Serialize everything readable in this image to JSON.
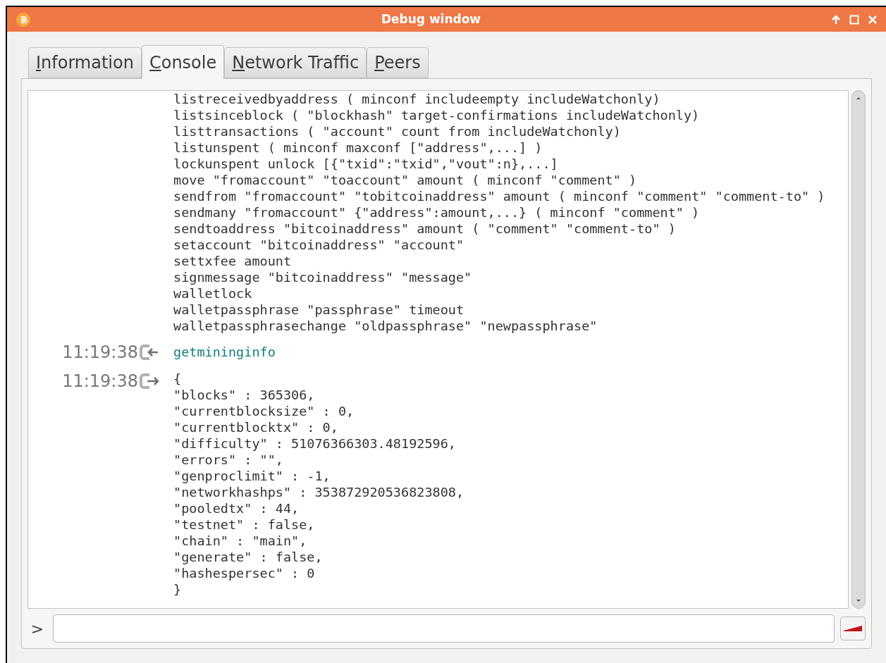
{
  "window": {
    "title": "Debug window"
  },
  "tabs": [
    {
      "label": "Information",
      "selected": false
    },
    {
      "label": "Console",
      "selected": true
    },
    {
      "label": "Network Traffic",
      "selected": false
    },
    {
      "label": "Peers",
      "selected": false
    }
  ],
  "console": {
    "entries": [
      {
        "kind": "reply",
        "lines": [
          "listreceivedbyaddress ( minconf includeempty includeWatchonly)",
          "listsinceblock ( \"blockhash\" target-confirmations includeWatchonly)",
          "listtransactions ( \"account\" count from includeWatchonly)",
          "listunspent ( minconf maxconf [\"address\",...] )",
          "lockunspent unlock [{\"txid\":\"txid\",\"vout\":n},...]",
          "move \"fromaccount\" \"toaccount\" amount ( minconf \"comment\" )",
          "sendfrom \"fromaccount\" \"tobitcoinaddress\" amount ( minconf \"comment\" \"comment-to\" )",
          "sendmany \"fromaccount\" {\"address\":amount,...} ( minconf \"comment\" )",
          "sendtoaddress \"bitcoinaddress\" amount ( \"comment\" \"comment-to\" )",
          "setaccount \"bitcoinaddress\" \"account\"",
          "settxfee amount",
          "signmessage \"bitcoinaddress\" \"message\"",
          "walletlock",
          "walletpassphrase \"passphrase\" timeout",
          "walletpassphrasechange \"oldpassphrase\" \"newpassphrase\""
        ]
      },
      {
        "kind": "command",
        "time": "11:19:38",
        "lines": [
          "getmininginfo"
        ]
      },
      {
        "kind": "reply",
        "time": "11:19:38",
        "lines": [
          "{",
          "\"blocks\" : 365306,",
          "\"currentblocksize\" : 0,",
          "\"currentblocktx\" : 0,",
          "\"difficulty\" : 51076366303.48192596,",
          "\"errors\" : \"\",",
          "\"genproclimit\" : -1,",
          "\"networkhashps\" : 353872920536823808,",
          "\"pooledtx\" : 44,",
          "\"testnet\" : false,",
          "\"chain\" : \"main\",",
          "\"generate\" : false,",
          "\"hashespersec\" : 0",
          "}"
        ]
      }
    ]
  },
  "prompt": ">"
}
